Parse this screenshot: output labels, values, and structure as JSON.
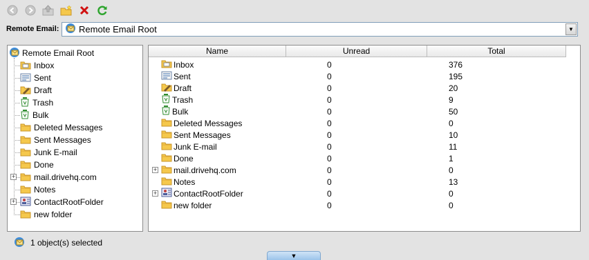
{
  "toolbar": {
    "buttons": [
      {
        "name": "back-icon"
      },
      {
        "name": "forward-icon"
      },
      {
        "name": "up-folder-icon"
      },
      {
        "name": "new-folder-icon"
      },
      {
        "name": "delete-icon"
      },
      {
        "name": "refresh-icon"
      }
    ]
  },
  "address": {
    "label": "Remote Email:",
    "value": "Remote Email Root"
  },
  "tree": {
    "root": "Remote Email Root",
    "items": [
      {
        "label": "Inbox",
        "icon": "inbox-icon"
      },
      {
        "label": "Sent",
        "icon": "sent-icon"
      },
      {
        "label": "Draft",
        "icon": "draft-icon"
      },
      {
        "label": "Trash",
        "icon": "trash-icon"
      },
      {
        "label": "Bulk",
        "icon": "bulk-icon"
      },
      {
        "label": "Deleted Messages",
        "icon": "folder-icon"
      },
      {
        "label": "Sent Messages",
        "icon": "folder-icon"
      },
      {
        "label": "Junk E-mail",
        "icon": "folder-icon"
      },
      {
        "label": "Done",
        "icon": "folder-icon"
      },
      {
        "label": "mail.drivehq.com",
        "icon": "folder-icon",
        "expandable": true
      },
      {
        "label": "Notes",
        "icon": "folder-icon"
      },
      {
        "label": "ContactRootFolder",
        "icon": "contacts-icon",
        "expandable": true
      },
      {
        "label": "new folder",
        "icon": "folder-icon"
      }
    ]
  },
  "list": {
    "columns": [
      "Name",
      "Unread",
      "Total"
    ],
    "rows": [
      {
        "name": "Inbox",
        "unread": "0",
        "total": "376",
        "icon": "inbox-icon"
      },
      {
        "name": "Sent",
        "unread": "0",
        "total": "195",
        "icon": "sent-icon"
      },
      {
        "name": "Draft",
        "unread": "0",
        "total": "20",
        "icon": "draft-icon"
      },
      {
        "name": "Trash",
        "unread": "0",
        "total": "9",
        "icon": "trash-icon"
      },
      {
        "name": "Bulk",
        "unread": "0",
        "total": "50",
        "icon": "bulk-icon"
      },
      {
        "name": "Deleted Messages",
        "unread": "0",
        "total": "0",
        "icon": "folder-icon"
      },
      {
        "name": "Sent Messages",
        "unread": "0",
        "total": "10",
        "icon": "folder-icon"
      },
      {
        "name": "Junk E-mail",
        "unread": "0",
        "total": "11",
        "icon": "folder-icon"
      },
      {
        "name": "Done",
        "unread": "0",
        "total": "1",
        "icon": "folder-icon"
      },
      {
        "name": "mail.drivehq.com",
        "unread": "0",
        "total": "0",
        "icon": "folder-icon",
        "expandable": true
      },
      {
        "name": "Notes",
        "unread": "0",
        "total": "13",
        "icon": "folder-icon"
      },
      {
        "name": "ContactRootFolder",
        "unread": "0",
        "total": "0",
        "icon": "contacts-icon",
        "expandable": true
      },
      {
        "name": "new folder",
        "unread": "0",
        "total": "0",
        "icon": "folder-icon"
      }
    ]
  },
  "status": {
    "text": "1 object(s) selected"
  },
  "colors": {
    "folder": "#f5c84c",
    "delete": "#d01010",
    "refresh": "#2fa52f"
  }
}
